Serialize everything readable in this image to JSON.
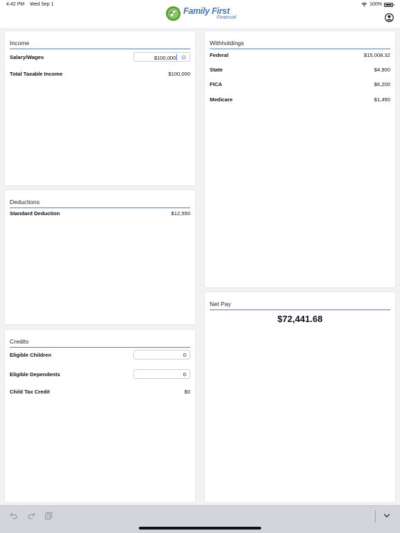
{
  "status_bar": {
    "time": "4:42 PM",
    "date": "Wed Sep 1",
    "battery": "100%"
  },
  "header": {
    "logo_main": "Family First",
    "logo_sub": "Financial"
  },
  "income": {
    "title": "Income",
    "salary_label": "Salary/Wages",
    "salary_value": "$100,000",
    "total_label": "Total Taxable Income",
    "total_value": "$100,000"
  },
  "deductions": {
    "title": "Deductions",
    "standard_label": "Standard Deduction",
    "standard_value": "$12,550"
  },
  "credits": {
    "title": "Credits",
    "children_label": "Eligible Children",
    "children_value": "0",
    "dependents_label": "Eligible Dependents",
    "dependents_value": "0",
    "child_tax_label": "Child Tax Credit",
    "child_tax_value": "$0"
  },
  "withholdings": {
    "title": "Withholdings",
    "items": [
      {
        "label": "Federal",
        "value": "$15,008.32"
      },
      {
        "label": "State",
        "value": "$4,900"
      },
      {
        "label": "FICA",
        "value": "$6,200"
      },
      {
        "label": "Medicare",
        "value": "$1,450"
      }
    ]
  },
  "net_pay": {
    "title": "Net Pay",
    "value": "$72,441.68"
  },
  "toolbar": {
    "icons": [
      "undo-icon",
      "redo-icon",
      "clipboard-icon",
      "chevron-down-icon"
    ]
  },
  "colors": {
    "accent": "#4a73a8",
    "logo_green": "#5a9e3a",
    "divider": "#5f7ea3"
  }
}
